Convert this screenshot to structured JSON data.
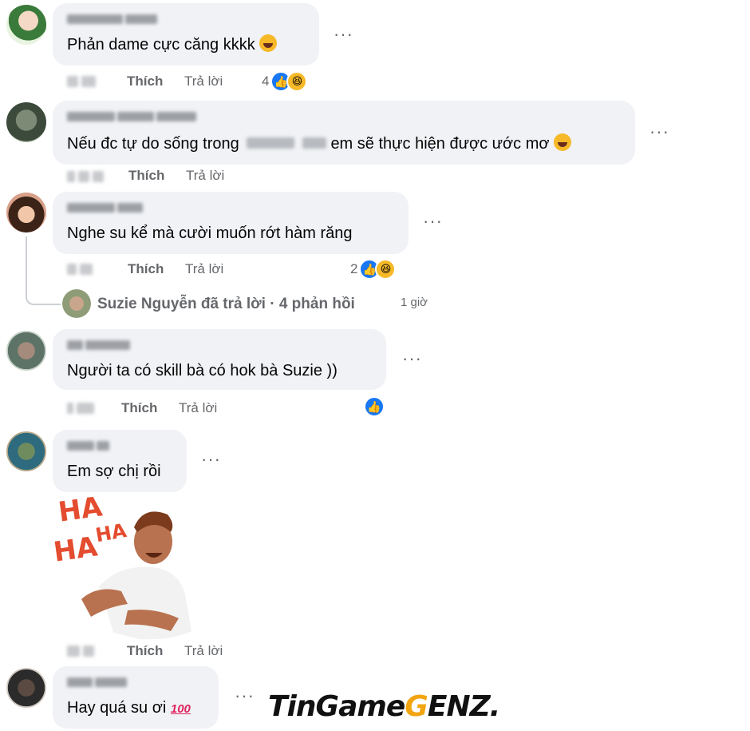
{
  "actions": {
    "like": "Thích",
    "reply": "Trả lời",
    "more": "···"
  },
  "comments": [
    {
      "text": "Phản dame cực căng kkkk",
      "reaction_count": "4"
    },
    {
      "text_before": "Nếu đc tự do sống trong",
      "text_after": "em sẽ thực hiện được ước mơ"
    },
    {
      "text": "Nghe su kể mà cười muốn rớt hàm răng",
      "reaction_count": "2"
    },
    {
      "text": "Người ta có skill bà có hok bà Suzie ))"
    },
    {
      "text": "Em sợ chị rồi",
      "sticker_text": [
        "HA",
        "HA",
        "HA"
      ]
    },
    {
      "text": "Hay quá su ơi",
      "emoji": "100"
    }
  ],
  "replies_summary": {
    "label": "Suzie Nguyễn đã trả lời · 4 phản hồi",
    "time": "1 giờ"
  },
  "watermark": {
    "part1": "TinGame",
    "part2": "G",
    "part3": "ENZ."
  },
  "colors": {
    "accent_like": "#1877f2",
    "haha": "#f7b928",
    "bubble": "#f0f2f5",
    "secondary_text": "#65676b"
  }
}
